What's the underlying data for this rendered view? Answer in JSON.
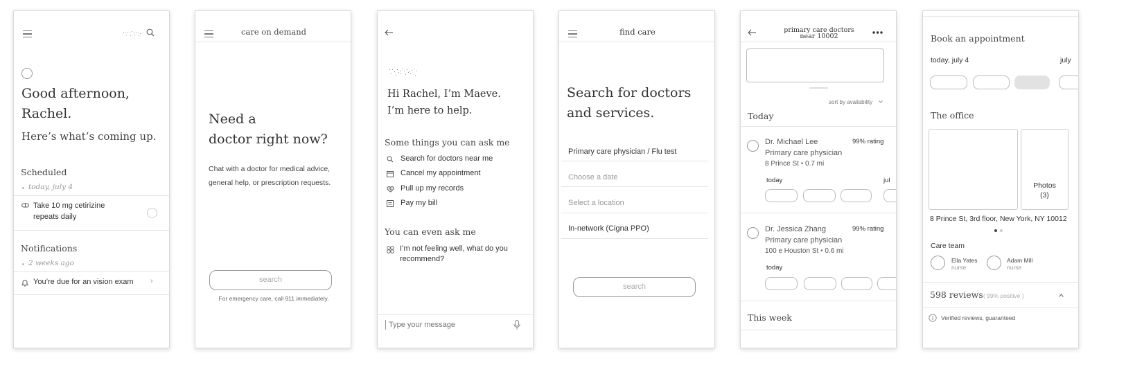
{
  "screen1": {
    "greeting": "Good afternoon,",
    "name": "Rachel.",
    "subtitle": "Here’s what’s coming up.",
    "scheduled_heading": "Scheduled",
    "scheduled_date": "today, july 4",
    "task_title": "Take 10 mg cetirizine",
    "task_repeat": "repeats daily",
    "notifications_heading": "Notifications",
    "notifications_date": "2 weeks ago",
    "notification_text": "You’re due for an vision exam",
    "notification_chevron": "›"
  },
  "screen2": {
    "header_title": "care on demand",
    "headline_1": "Need a",
    "headline_2": "doctor right now?",
    "body": "Chat with a doctor for medical advice, general help, or prescription requests.",
    "search_button": "search",
    "footnote": "For emergency care, call 911 immediately."
  },
  "screen3": {
    "intro_1": "Hi Rachel, I’m Maeve.",
    "intro_2": "I’m here to help.",
    "ask_heading": "Some things you can ask me",
    "suggestions": [
      {
        "label": "Search for doctors near me",
        "icon": "search-icon"
      },
      {
        "label": "Cancel my appointment",
        "icon": "calendar-icon"
      },
      {
        "label": "Pull up my records",
        "icon": "records-icon"
      },
      {
        "label": "Pay my bill",
        "icon": "bill-icon"
      }
    ],
    "even_heading": "You can even ask me",
    "even_text_1": "I’m not feeling well, what do you",
    "even_text_2": "recommend?",
    "message_placeholder": "Type your message"
  },
  "screen4": {
    "header_title": "find care",
    "headline_1": "Search for doctors",
    "headline_2": "and services.",
    "field_service": "Primary care physician / Flu test",
    "field_date_placeholder": "Choose a date",
    "field_location_placeholder": "Select a location",
    "field_network": "In-network (Cigna PPO)",
    "search_button": "search"
  },
  "screen5": {
    "header_title_1": "primary care doctors",
    "header_title_2": "near 10002",
    "sort_label": "sort by availability",
    "today_heading": "Today",
    "doctors": [
      {
        "name": "Dr. Michael Lee",
        "specialty": "Primary care physician",
        "address": "8 Prince St",
        "distance": "0.7 mi",
        "rating": "99% rating",
        "day_label": "today",
        "next_label": "jul"
      },
      {
        "name": "Dr. Jessica Zhang",
        "specialty": "Primary care physician",
        "address": "100 e Houston St",
        "distance": "0.6 mi",
        "rating": "99% rating",
        "day_label": "today"
      }
    ],
    "week_heading": "This week"
  },
  "screen6": {
    "book_heading": "Book an appointment",
    "date_today": "today, july 4",
    "date_next": "july",
    "office_heading": "The office",
    "photos_label": "Photos",
    "photos_count": "(3)",
    "address": "8 Prince St, 3rd floor, New York, NY 10012",
    "care_team_heading": "Care team",
    "team": [
      {
        "name": "Ella Yates",
        "role": "nurse"
      },
      {
        "name": "Adam Mill",
        "role": "nurse"
      }
    ],
    "reviews_count": "598 reviews",
    "reviews_positive": "( 99% positive )",
    "verified_text": "Verified reviews, guaranteed"
  }
}
